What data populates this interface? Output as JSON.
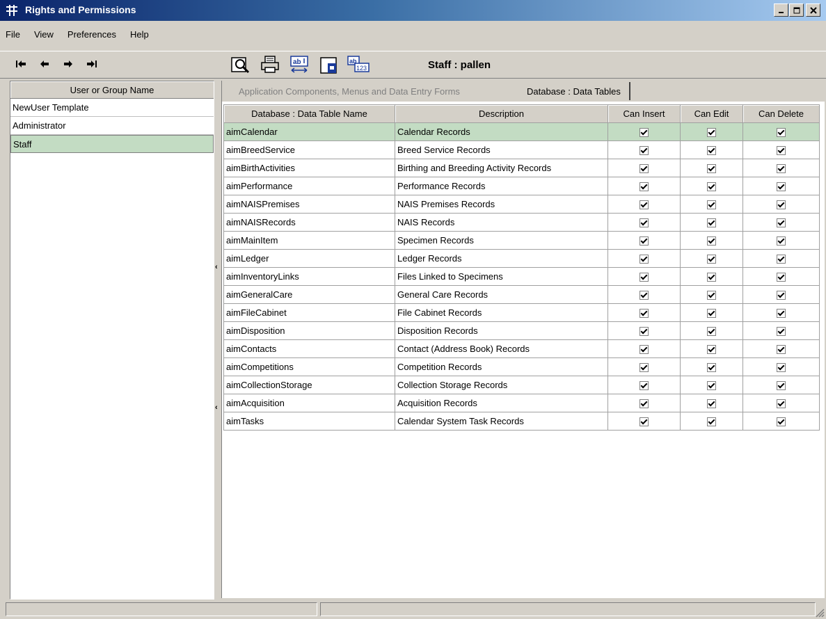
{
  "window": {
    "title": "Rights and Permissions",
    "icon": "app-grid-icon"
  },
  "menu": [
    "File",
    "View",
    "Preferences",
    "Help"
  ],
  "toolbar": {
    "nav": [
      "first-record-icon",
      "previous-record-icon",
      "next-record-icon",
      "last-record-icon"
    ],
    "tools": [
      "search-icon",
      "print-icon",
      "spell-check-icon",
      "save-icon",
      "field-format-icon"
    ],
    "staff_label": "Staff : pallen"
  },
  "left": {
    "header": "User or Group Name",
    "items": [
      "NewUser Template",
      "Administrator",
      "Staff"
    ],
    "selected": "Staff"
  },
  "tabs": {
    "inactive": "Application Components, Menus and Data Entry Forms",
    "active": "Database : Data Tables"
  },
  "table": {
    "columns": [
      "Database : Data Table Name",
      "Description",
      "Can Insert",
      "Can Edit",
      "Can Delete"
    ],
    "rows": [
      {
        "name": "aimCalendar",
        "desc": "Calendar Records"
      },
      {
        "name": "aimBreedService",
        "desc": "Breed Service Records"
      },
      {
        "name": "aimBirthActivities",
        "desc": "Birthing and Breeding Activity Records"
      },
      {
        "name": "aimPerformance",
        "desc": "Performance Records"
      },
      {
        "name": "aimNAISPremises",
        "desc": "NAIS Premises Records"
      },
      {
        "name": "aimNAISRecords",
        "desc": "NAIS Records"
      },
      {
        "name": "aimMainItem",
        "desc": "Specimen Records"
      },
      {
        "name": "aimLedger",
        "desc": "Ledger Records"
      },
      {
        "name": "aimInventoryLinks",
        "desc": "Files Linked to Specimens"
      },
      {
        "name": "aimGeneralCare",
        "desc": "General Care Records"
      },
      {
        "name": "aimFileCabinet",
        "desc": "File Cabinet Records"
      },
      {
        "name": "aimDisposition",
        "desc": "Disposition Records"
      },
      {
        "name": "aimContacts",
        "desc": "Contact (Address Book) Records"
      },
      {
        "name": "aimCompetitions",
        "desc": "Competition Records"
      },
      {
        "name": "aimCollectionStorage",
        "desc": "Collection Storage Records"
      },
      {
        "name": "aimAcquisition",
        "desc": "Acquisition Records"
      },
      {
        "name": "aimTasks",
        "desc": "Calendar System Task Records"
      }
    ],
    "all_checked": true
  },
  "colors": {
    "selection": "#c3dcc3",
    "chrome": "#d4d0c8",
    "title_start": "#0a246a"
  }
}
